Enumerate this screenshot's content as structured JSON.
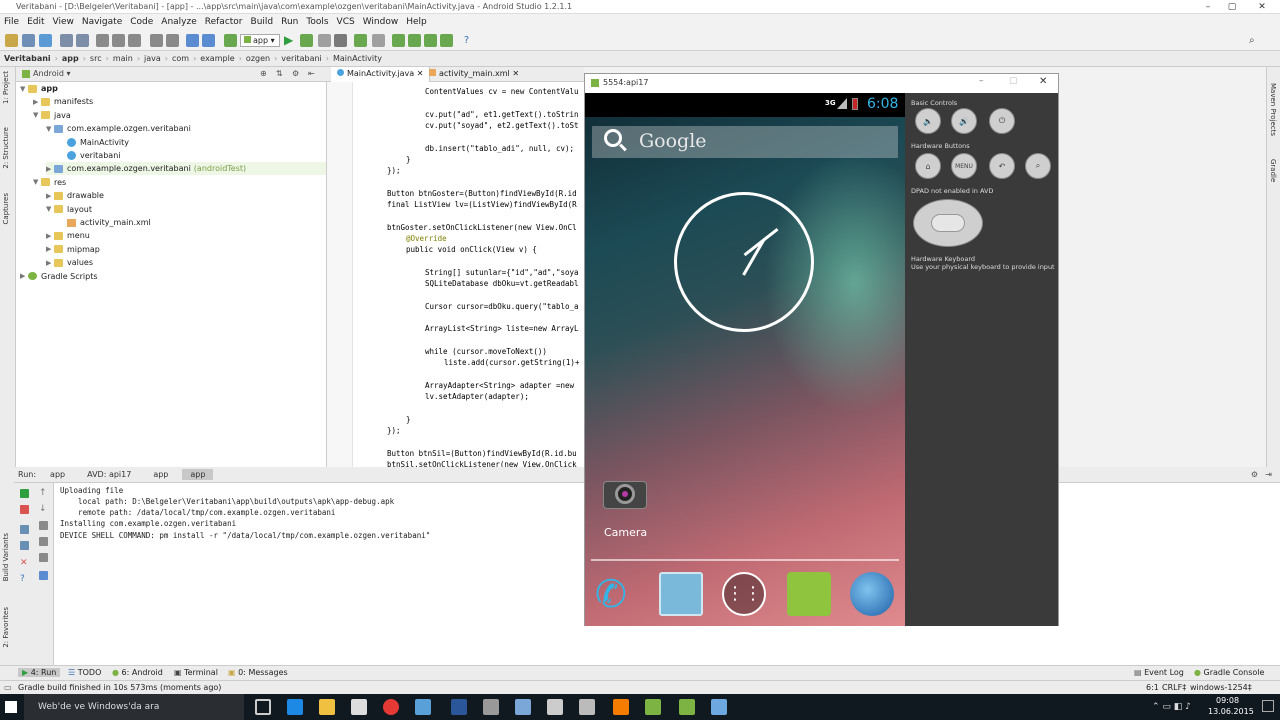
{
  "window": {
    "title": "Veritabani - [D:\\Belgeler\\Veritabani] - [app] - ...\\app\\src\\main\\java\\com\\example\\ozgen\\veritabani\\MainActivity.java - Android Studio 1.2.1.1"
  },
  "menu": [
    "File",
    "Edit",
    "View",
    "Navigate",
    "Code",
    "Analyze",
    "Refactor",
    "Build",
    "Run",
    "Tools",
    "VCS",
    "Window",
    "Help"
  ],
  "toolbar": {
    "run_config": "app"
  },
  "breadcrumb": [
    "Veritabani",
    "app",
    "src",
    "main",
    "java",
    "com",
    "example",
    "ozgen",
    "veritabani",
    "MainActivity"
  ],
  "sidebar_left": [
    "1: Project",
    "2: Structure",
    "Captures",
    "Build Variants",
    "2: Favorites"
  ],
  "project": {
    "view_mode": "Android",
    "tree": [
      {
        "label": "app",
        "depth": 0,
        "icon": "folder"
      },
      {
        "label": "manifests",
        "depth": 1,
        "icon": "folder"
      },
      {
        "label": "java",
        "depth": 1,
        "icon": "folder"
      },
      {
        "label": "com.example.ozgen.veritabani",
        "depth": 2,
        "icon": "package"
      },
      {
        "label": "MainActivity",
        "depth": 3,
        "icon": "class"
      },
      {
        "label": "veritabani",
        "depth": 3,
        "icon": "class"
      },
      {
        "label": "com.example.ozgen.veritabani",
        "suffix": "(androidTest)",
        "depth": 2,
        "icon": "package"
      },
      {
        "label": "res",
        "depth": 1,
        "icon": "folder"
      },
      {
        "label": "drawable",
        "depth": 2,
        "icon": "folder"
      },
      {
        "label": "layout",
        "depth": 2,
        "icon": "folder"
      },
      {
        "label": "activity_main.xml",
        "depth": 3,
        "icon": "xml"
      },
      {
        "label": "menu",
        "depth": 2,
        "icon": "folder"
      },
      {
        "label": "mipmap",
        "depth": 2,
        "icon": "folder"
      },
      {
        "label": "values",
        "depth": 2,
        "icon": "folder"
      },
      {
        "label": "Gradle Scripts",
        "depth": 0,
        "icon": "gradle"
      }
    ]
  },
  "editor": {
    "tabs": [
      "MainActivity.java",
      "activity_main.xml"
    ],
    "lines": [
      "ContentValues cv = new ContentValu",
      "",
      "cv.put(\"ad\", et1.getText().toStrin",
      "cv.put(\"soyad\", et2.getText().toSt",
      "",
      "db.insert(\"tablo_adi\", null, cv);",
      "}",
      "});",
      "",
      "Button btnGoster=(Button)findViewById(R.id",
      "final ListView lv=(ListView)findViewById(R",
      "",
      "btnGoster.setOnClickListener(new View.OnCl",
      "@Override",
      "public void onClick(View v) {",
      "",
      "String[] sutunlar={\"id\",\"ad\",\"soya",
      "SQLiteDatabase dbOku=vt.getReadabl",
      "",
      "Cursor cursor=dbOku.query(\"tablo_a",
      "",
      "ArrayList<String> liste=new ArrayL",
      "",
      "while (cursor.moveToNext())",
      "liste.add(cursor.getString(1)+",
      "",
      "ArrayAdapter<String> adapter =new",
      "lv.setAdapter(adapter);",
      "",
      "}",
      "});",
      "",
      "Button btnSil=(Button)findViewById(R.id.bu",
      "btnSil.setOnClickListener(new View.OnClick"
    ]
  },
  "run": {
    "label": "Run:",
    "tabs": [
      "app",
      "AVD: api17",
      "app",
      "app"
    ],
    "console": [
      "Uploading file",
      "    local path: D:\\Belgeler\\Veritabani\\app\\build\\outputs\\apk\\app-debug.apk",
      "    remote path: /data/local/tmp/com.example.ozgen.veritabani",
      "Installing com.example.ozgen.veritabani",
      "DEVICE SHELL COMMAND: pm install -r \"/data/local/tmp/com.example.ozgen.veritabani\""
    ]
  },
  "bottom_tabs": [
    "4: Run",
    "TODO",
    "6: Android",
    "Terminal",
    "0: Messages"
  ],
  "bottom_right": [
    "Event Log",
    "Gradle Console"
  ],
  "status": {
    "message": "Gradle build finished in 10s 573ms (moments ago)",
    "position": "6:1",
    "line_sep": "CRLF‡",
    "encoding": "windows-1254‡"
  },
  "right_strip": [
    "Maven Projects",
    "Gradle"
  ],
  "emulator": {
    "title": "5554:api17",
    "time": "6:08",
    "network": "3G",
    "search_label": "Google",
    "app_label": "Camera",
    "controls": {
      "basic": "Basic Controls",
      "hardware": "Hardware Buttons",
      "dpad": "DPAD not enabled in AVD",
      "keyboard": "Hardware Keyboard",
      "keyboard_hint": "Use your physical keyboard to provide input",
      "menu_label": "MENU"
    }
  },
  "taskbar": {
    "search": "Web'de ve Windows'da ara",
    "time": "09:08",
    "date": "13.06.2015"
  },
  "colors": {
    "accent": "#4aa3df",
    "editor_bg": "#ffffff",
    "taskbar": "#101820",
    "emu_panel": "#3a3a3a"
  }
}
